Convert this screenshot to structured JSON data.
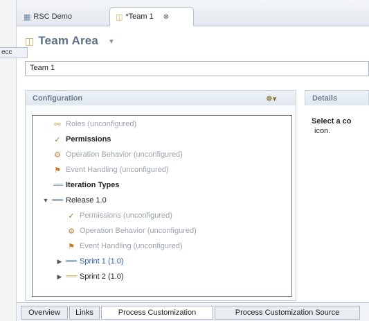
{
  "gutter": {
    "tab_text": "ecc"
  },
  "tabs": [
    {
      "label": "RSC  Demo"
    },
    {
      "label": "*Team 1",
      "close": "⊗"
    }
  ],
  "header": {
    "title": "Team Area",
    "dropdown": "▾"
  },
  "name_field": {
    "value": "Team 1"
  },
  "configuration": {
    "title": "Configuration",
    "toolbar_icon": "☸▾",
    "tree": [
      {
        "label": "Roles (unconfigured)"
      },
      {
        "label": "Permissions"
      },
      {
        "label": "Operation Behavior (unconfigured)"
      },
      {
        "label": "Event Handling (unconfigured)"
      },
      {
        "label": "Iteration Types"
      },
      {
        "label": "Release 1.0"
      },
      {
        "label": "Permissions (unconfigured)"
      },
      {
        "label": "Operation Behavior (unconfigured)"
      },
      {
        "label": "Event Handling (unconfigured)"
      },
      {
        "label": "Sprint 1 (1.0)"
      },
      {
        "label": "Sprint 2 (1.0)"
      }
    ]
  },
  "details": {
    "title": "Details",
    "text_bold": "Select a co",
    "text_rest": "icon."
  },
  "bottom_tabs": [
    {
      "label": "Overview"
    },
    {
      "label": "Links"
    },
    {
      "label": "Process Customization"
    },
    {
      "label": "Process Customization Source"
    }
  ],
  "icons": {
    "roles": "roles-icon",
    "permissions": "permissions-icon",
    "operation": "operation-behavior-icon",
    "event": "event-handling-icon",
    "iteration": "iteration-types-icon",
    "release": "release-icon",
    "sprint": "sprint-icon"
  }
}
